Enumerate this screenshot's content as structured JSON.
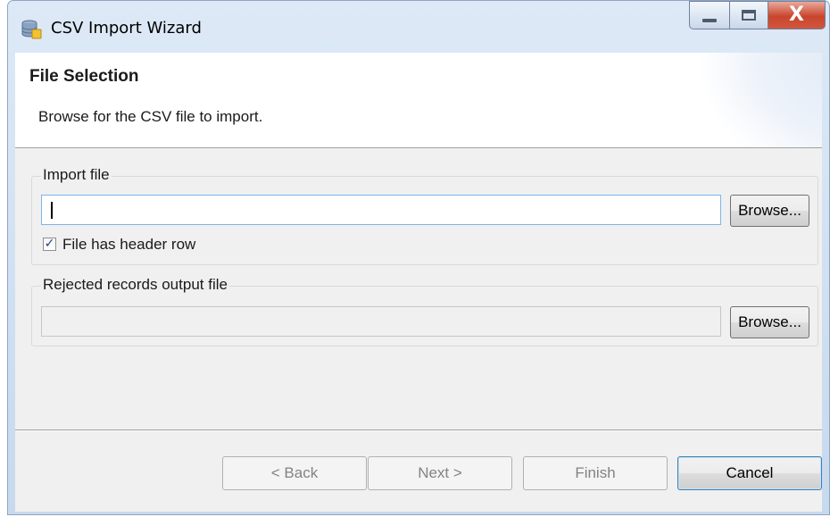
{
  "window": {
    "title": "CSV Import Wizard",
    "icon": "database-icon",
    "controls": {
      "minimize": "minimize-icon",
      "maximize": "maximize-icon",
      "close_label": "X"
    }
  },
  "header": {
    "title": "File Selection",
    "description": "Browse for the CSV file to import."
  },
  "import_group": {
    "label": "Import file",
    "file_value": "",
    "browse_label": "Browse...",
    "header_row_label": "File has header row",
    "header_row_checked": true
  },
  "rejected_group": {
    "label": "Rejected records output file",
    "file_value": "",
    "browse_label": "Browse..."
  },
  "footer": {
    "back_label": "< Back",
    "next_label": "Next >",
    "finish_label": "Finish",
    "cancel_label": "Cancel"
  },
  "colors": {
    "client_bg": "#f0f0f0",
    "banner_bg": "#ffffff",
    "close_red": "#c9452c",
    "focus_blue": "#7eb4ea"
  }
}
